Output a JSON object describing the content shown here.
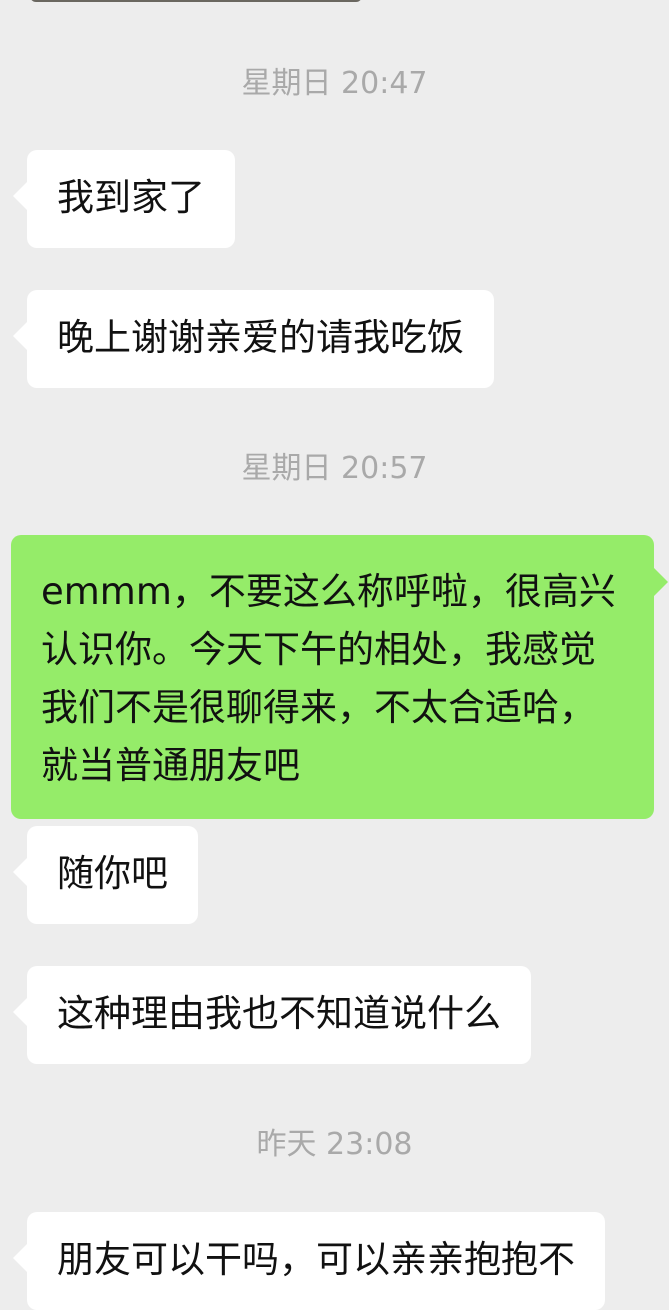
{
  "chat": {
    "timestamps": [
      "星期日 20:47",
      "星期日 20:57",
      "昨天 23:08"
    ],
    "messages": [
      {
        "from": "other",
        "text": "我到家了"
      },
      {
        "from": "other",
        "text": "晚上谢谢亲爱的请我吃饭"
      },
      {
        "from": "me",
        "text": "emmm，不要这么称呼啦，很高兴认识你。今天下午的相处，我感觉我们不是很聊得来，不太合适哈，就当普通朋友吧"
      },
      {
        "from": "other",
        "text": "随你吧"
      },
      {
        "from": "other",
        "text": "这种理由我也不知道说什么"
      },
      {
        "from": "other",
        "text": "朋友可以干吗，可以亲亲抱抱不"
      }
    ]
  },
  "colors": {
    "background": "#ededed",
    "incoming_bubble": "#ffffff",
    "outgoing_bubble": "#95ec69",
    "timestamp_text": "#a9a9a9"
  }
}
